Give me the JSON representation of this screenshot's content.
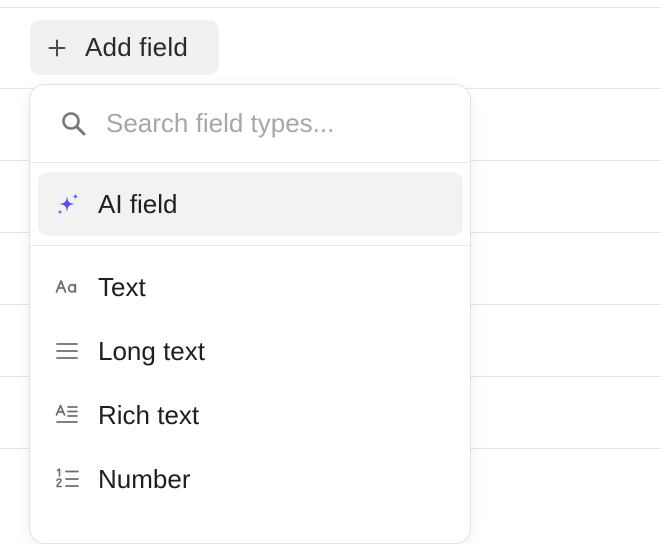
{
  "toolbar": {
    "add_field_label": "Add field"
  },
  "menu": {
    "search": {
      "placeholder": "Search field types...",
      "value": ""
    },
    "ai_item": {
      "label": "AI field",
      "icon": "sparkle-icon",
      "accent": "#5b4ef0"
    },
    "types": [
      {
        "label": "Text",
        "icon": "text-aa-icon"
      },
      {
        "label": "Long text",
        "icon": "lines-icon"
      },
      {
        "label": "Rich text",
        "icon": "rich-text-icon"
      },
      {
        "label": "Number",
        "icon": "number-list-icon"
      }
    ]
  },
  "colors": {
    "icon_gray": "#6e6e6e",
    "placeholder": "#a7a7a7",
    "selected_bg": "#f2f2f2",
    "button_bg": "#f1f1f1"
  }
}
